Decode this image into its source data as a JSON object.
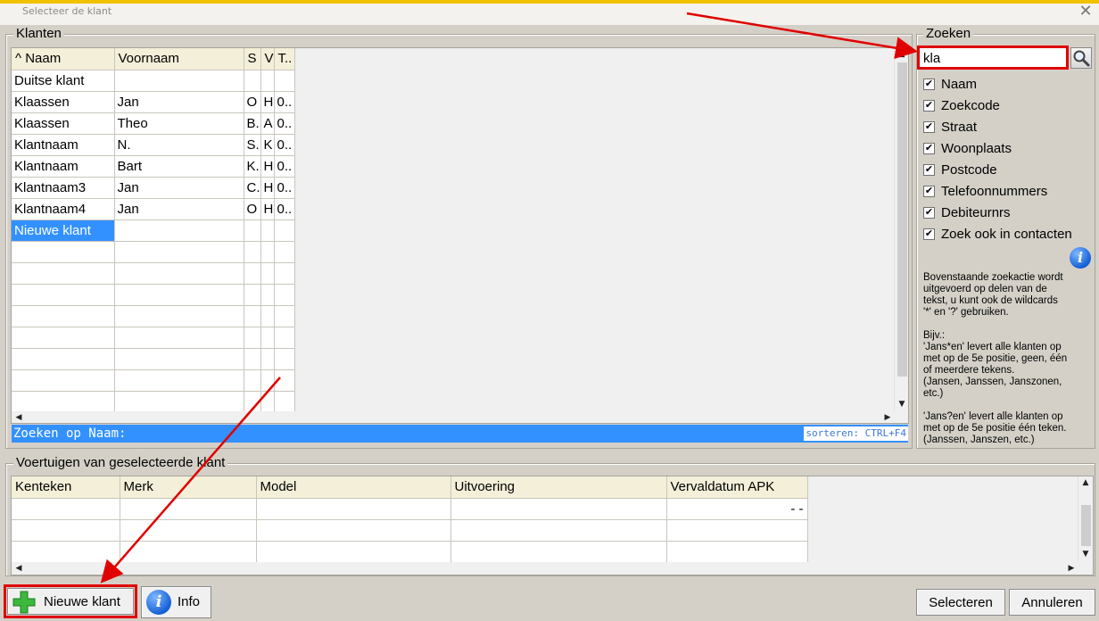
{
  "window": {
    "title": "Selecteer de klant"
  },
  "klanten": {
    "legend": "Klanten",
    "columns": [
      "^ Naam",
      "Voornaam",
      "S",
      "V",
      "T.."
    ],
    "rows": [
      [
        "Duitse klant",
        "",
        "",
        "",
        ""
      ],
      [
        "Klaassen",
        "Jan",
        "O",
        "H",
        "0.."
      ],
      [
        "Klaassen",
        "Theo",
        "B.",
        "A",
        "0.."
      ],
      [
        "Klantnaam",
        "N.",
        "S.",
        "K",
        "0.."
      ],
      [
        "Klantnaam",
        "Bart",
        "K.",
        "H",
        "0.."
      ],
      [
        "Klantnaam3",
        "Jan",
        "C.",
        "H",
        "0.."
      ],
      [
        "Klantnaam4",
        "Jan",
        "O",
        "H",
        "0.."
      ],
      [
        "Nieuwe klant",
        "",
        "",
        "",
        ""
      ]
    ],
    "selected_index": 7,
    "empty_rows": 8,
    "search_label": "Zoeken op Naam:",
    "sort_hint": "sorteren: CTRL+F4"
  },
  "zoeken": {
    "legend": "Zoeken",
    "query": "kla",
    "options": [
      {
        "label": "Naam",
        "checked": true
      },
      {
        "label": "Zoekcode",
        "checked": true
      },
      {
        "label": "Straat",
        "checked": true
      },
      {
        "label": "Woonplaats",
        "checked": true
      },
      {
        "label": "Postcode",
        "checked": true
      },
      {
        "label": "Telefoonnummers",
        "checked": true
      },
      {
        "label": "Debiteurnrs",
        "checked": true
      },
      {
        "label": "Zoek ook in contacten",
        "checked": true
      }
    ],
    "help_lines": [
      "Bovenstaande zoekactie wordt",
      "uitgevoerd op delen van de",
      "tekst, u kunt ook de wildcards",
      "'*' en '?' gebruiken.",
      "",
      "Bijv.:",
      "'Jans*en' levert alle klanten op",
      "met op de 5e positie, geen, één",
      "of meerdere tekens.",
      "(Jansen, Janssen, Janszonen,",
      "etc.)",
      "",
      "'Jans?en' levert alle klanten op",
      "met op de 5e positie één teken.",
      "(Janssen, Janszen, etc.)"
    ]
  },
  "voertuigen": {
    "legend": "Voertuigen van geselecteerde klant",
    "columns": [
      "Kenteken",
      "Merk",
      "Model",
      "Uitvoering",
      "Vervaldatum APK"
    ],
    "rows": [
      [
        "",
        "",
        "",
        "",
        "-  -"
      ],
      [
        "",
        "",
        "",
        "",
        ""
      ],
      [
        "",
        "",
        "",
        "",
        ""
      ]
    ]
  },
  "buttons": {
    "new_customer": "Nieuwe klant",
    "info": "Info",
    "select": "Selecteren",
    "cancel": "Annuleren"
  },
  "colors": {
    "selection": "#3391ff",
    "highlight": "#e00000",
    "header_bg": "#f4efd8",
    "window_bg": "#d4d0c8"
  }
}
